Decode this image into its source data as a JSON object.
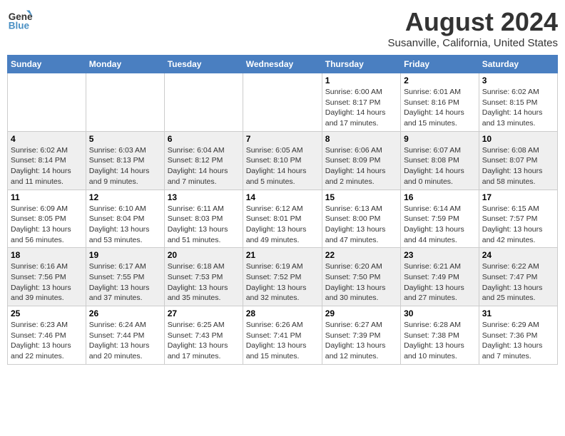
{
  "header": {
    "logo_line1": "General",
    "logo_line2": "Blue",
    "month_year": "August 2024",
    "location": "Susanville, California, United States"
  },
  "days_of_week": [
    "Sunday",
    "Monday",
    "Tuesday",
    "Wednesday",
    "Thursday",
    "Friday",
    "Saturday"
  ],
  "weeks": [
    [
      {
        "day": "",
        "info": ""
      },
      {
        "day": "",
        "info": ""
      },
      {
        "day": "",
        "info": ""
      },
      {
        "day": "",
        "info": ""
      },
      {
        "day": "1",
        "info": "Sunrise: 6:00 AM\nSunset: 8:17 PM\nDaylight: 14 hours\nand 17 minutes."
      },
      {
        "day": "2",
        "info": "Sunrise: 6:01 AM\nSunset: 8:16 PM\nDaylight: 14 hours\nand 15 minutes."
      },
      {
        "day": "3",
        "info": "Sunrise: 6:02 AM\nSunset: 8:15 PM\nDaylight: 14 hours\nand 13 minutes."
      }
    ],
    [
      {
        "day": "4",
        "info": "Sunrise: 6:02 AM\nSunset: 8:14 PM\nDaylight: 14 hours\nand 11 minutes."
      },
      {
        "day": "5",
        "info": "Sunrise: 6:03 AM\nSunset: 8:13 PM\nDaylight: 14 hours\nand 9 minutes."
      },
      {
        "day": "6",
        "info": "Sunrise: 6:04 AM\nSunset: 8:12 PM\nDaylight: 14 hours\nand 7 minutes."
      },
      {
        "day": "7",
        "info": "Sunrise: 6:05 AM\nSunset: 8:10 PM\nDaylight: 14 hours\nand 5 minutes."
      },
      {
        "day": "8",
        "info": "Sunrise: 6:06 AM\nSunset: 8:09 PM\nDaylight: 14 hours\nand 2 minutes."
      },
      {
        "day": "9",
        "info": "Sunrise: 6:07 AM\nSunset: 8:08 PM\nDaylight: 14 hours\nand 0 minutes."
      },
      {
        "day": "10",
        "info": "Sunrise: 6:08 AM\nSunset: 8:07 PM\nDaylight: 13 hours\nand 58 minutes."
      }
    ],
    [
      {
        "day": "11",
        "info": "Sunrise: 6:09 AM\nSunset: 8:05 PM\nDaylight: 13 hours\nand 56 minutes."
      },
      {
        "day": "12",
        "info": "Sunrise: 6:10 AM\nSunset: 8:04 PM\nDaylight: 13 hours\nand 53 minutes."
      },
      {
        "day": "13",
        "info": "Sunrise: 6:11 AM\nSunset: 8:03 PM\nDaylight: 13 hours\nand 51 minutes."
      },
      {
        "day": "14",
        "info": "Sunrise: 6:12 AM\nSunset: 8:01 PM\nDaylight: 13 hours\nand 49 minutes."
      },
      {
        "day": "15",
        "info": "Sunrise: 6:13 AM\nSunset: 8:00 PM\nDaylight: 13 hours\nand 47 minutes."
      },
      {
        "day": "16",
        "info": "Sunrise: 6:14 AM\nSunset: 7:59 PM\nDaylight: 13 hours\nand 44 minutes."
      },
      {
        "day": "17",
        "info": "Sunrise: 6:15 AM\nSunset: 7:57 PM\nDaylight: 13 hours\nand 42 minutes."
      }
    ],
    [
      {
        "day": "18",
        "info": "Sunrise: 6:16 AM\nSunset: 7:56 PM\nDaylight: 13 hours\nand 39 minutes."
      },
      {
        "day": "19",
        "info": "Sunrise: 6:17 AM\nSunset: 7:55 PM\nDaylight: 13 hours\nand 37 minutes."
      },
      {
        "day": "20",
        "info": "Sunrise: 6:18 AM\nSunset: 7:53 PM\nDaylight: 13 hours\nand 35 minutes."
      },
      {
        "day": "21",
        "info": "Sunrise: 6:19 AM\nSunset: 7:52 PM\nDaylight: 13 hours\nand 32 minutes."
      },
      {
        "day": "22",
        "info": "Sunrise: 6:20 AM\nSunset: 7:50 PM\nDaylight: 13 hours\nand 30 minutes."
      },
      {
        "day": "23",
        "info": "Sunrise: 6:21 AM\nSunset: 7:49 PM\nDaylight: 13 hours\nand 27 minutes."
      },
      {
        "day": "24",
        "info": "Sunrise: 6:22 AM\nSunset: 7:47 PM\nDaylight: 13 hours\nand 25 minutes."
      }
    ],
    [
      {
        "day": "25",
        "info": "Sunrise: 6:23 AM\nSunset: 7:46 PM\nDaylight: 13 hours\nand 22 minutes."
      },
      {
        "day": "26",
        "info": "Sunrise: 6:24 AM\nSunset: 7:44 PM\nDaylight: 13 hours\nand 20 minutes."
      },
      {
        "day": "27",
        "info": "Sunrise: 6:25 AM\nSunset: 7:43 PM\nDaylight: 13 hours\nand 17 minutes."
      },
      {
        "day": "28",
        "info": "Sunrise: 6:26 AM\nSunset: 7:41 PM\nDaylight: 13 hours\nand 15 minutes."
      },
      {
        "day": "29",
        "info": "Sunrise: 6:27 AM\nSunset: 7:39 PM\nDaylight: 13 hours\nand 12 minutes."
      },
      {
        "day": "30",
        "info": "Sunrise: 6:28 AM\nSunset: 7:38 PM\nDaylight: 13 hours\nand 10 minutes."
      },
      {
        "day": "31",
        "info": "Sunrise: 6:29 AM\nSunset: 7:36 PM\nDaylight: 13 hours\nand 7 minutes."
      }
    ]
  ]
}
